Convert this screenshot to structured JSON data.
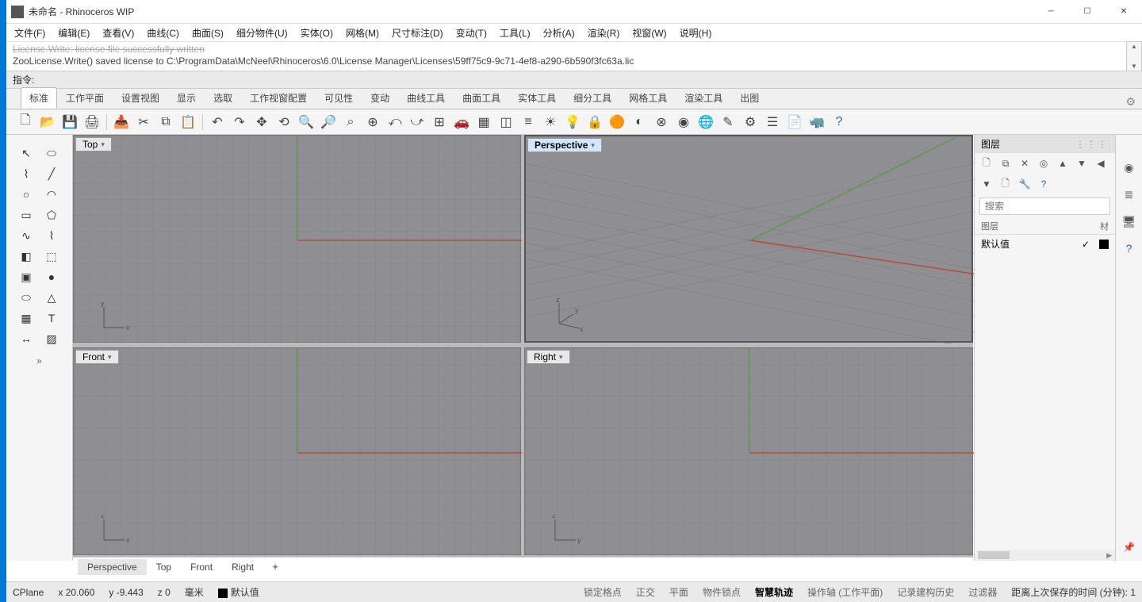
{
  "title": "未命名 - Rhinoceros WIP",
  "menu": [
    "文件(F)",
    "编辑(E)",
    "查看(V)",
    "曲线(C)",
    "曲面(S)",
    "细分物件(U)",
    "实体(O)",
    "网格(M)",
    "尺寸标注(D)",
    "变动(T)",
    "工具(L)",
    "分析(A)",
    "渲染(R)",
    "视窗(W)",
    "说明(H)"
  ],
  "console_line1": "License.Write: license file successfully written",
  "console_line2": "ZooLicense.Write() saved license to C:\\ProgramData\\McNeel\\Rhinoceros\\6.0\\License Manager\\Licenses\\59ff75c9-9c71-4ef8-a290-6b590f3fc63a.lic",
  "cmd_label": "指令:",
  "tabs": [
    "标准",
    "工作平面",
    "设置视图",
    "显示",
    "选取",
    "工作视窗配置",
    "可见性",
    "变动",
    "曲线工具",
    "曲面工具",
    "实体工具",
    "细分工具",
    "网格工具",
    "渲染工具",
    "出图"
  ],
  "active_tab": 0,
  "viewports": {
    "top": "Top",
    "perspective": "Perspective",
    "front": "Front",
    "right": "Right"
  },
  "vptabs": [
    "Perspective",
    "Top",
    "Front",
    "Right"
  ],
  "vptabs_active": 0,
  "right_panel": {
    "title": "图层",
    "search_placeholder": "搜索",
    "header_name": "图层",
    "header_mat": "材",
    "row": {
      "name": "默认值"
    }
  },
  "status": {
    "cplane": "CPlane",
    "x": "x 20.060",
    "y": "y -9.443",
    "z": "z 0",
    "unit": "毫米",
    "layer": "默认值",
    "toggles": [
      "锁定格点",
      "正交",
      "平面",
      "物件锁点",
      "智慧轨迹",
      "操作轴 (工作平面)",
      "记录建构历史",
      "过滤器"
    ],
    "toggles_active": 4,
    "time": "距离上次保存的时间 (分钟): 1"
  }
}
